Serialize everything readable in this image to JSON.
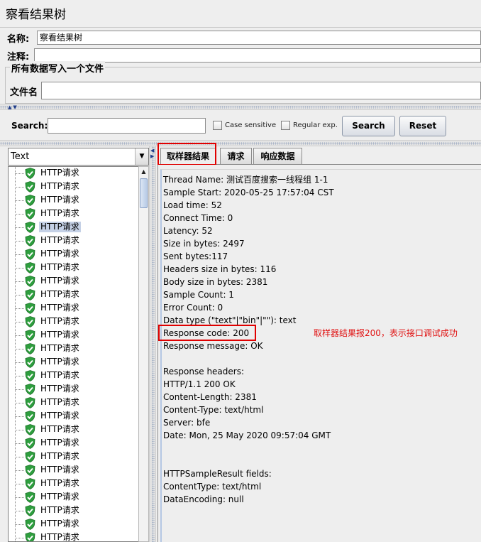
{
  "title": "察看结果树",
  "name_label": "名称:",
  "name_value": "察看结果树",
  "comment_label": "注释:",
  "comment_value": "",
  "file_group_title": "所有数据写入一个文件",
  "filename_label": "文件名",
  "filename_value": "",
  "search": {
    "label": "Search:",
    "value": "",
    "case_sensitive_label": "Case sensitive",
    "regex_label": "Regular exp.",
    "search_button": "Search",
    "reset_button": "Reset"
  },
  "renderer": {
    "selected": "Text"
  },
  "tree_items": [
    "HTTP请求",
    "HTTP请求",
    "HTTP请求",
    "HTTP请求",
    "HTTP请求",
    "HTTP请求",
    "HTTP请求",
    "HTTP请求",
    "HTTP请求",
    "HTTP请求",
    "HTTP请求",
    "HTTP请求",
    "HTTP请求",
    "HTTP请求",
    "HTTP请求",
    "HTTP请求",
    "HTTP请求",
    "HTTP请求",
    "HTTP请求",
    "HTTP请求",
    "HTTP请求",
    "HTTP请求",
    "HTTP请求",
    "HTTP请求",
    "HTTP请求",
    "HTTP请求",
    "HTTP请求",
    "HTTP请求"
  ],
  "selected_tree_index": 4,
  "tabs": [
    "取样器结果",
    "请求",
    "响应数据"
  ],
  "active_tab": 0,
  "details": [
    "Thread Name: 测试百度搜索一线程组 1-1",
    "Sample Start: 2020-05-25 17:57:04 CST",
    "Load time: 52",
    "Connect Time: 0",
    "Latency: 52",
    "Size in bytes: 2497",
    "Sent bytes:117",
    "Headers size in bytes: 116",
    "Body size in bytes: 2381",
    "Sample Count: 1",
    "Error Count: 0",
    "Data type (\"text\"|\"bin\"|\"\"): text",
    "Response code: 200",
    "Response message: OK",
    "",
    "Response headers:",
    "HTTP/1.1 200 OK",
    "Content-Length: 2381",
    "Content-Type: text/html",
    "Server: bfe",
    "Date: Mon, 25 May 2020 09:57:04 GMT",
    "",
    "",
    "HTTPSampleResult fields:",
    "ContentType: text/html",
    "DataEncoding: null"
  ],
  "annotation": "取样器结果报200，表示接口调试成功",
  "colors": {
    "highlight_box": "#e00000",
    "annotation": "#e01010",
    "selection": "#c5d1e6"
  },
  "icons": {
    "tree_item": "green-shield-check-icon"
  }
}
